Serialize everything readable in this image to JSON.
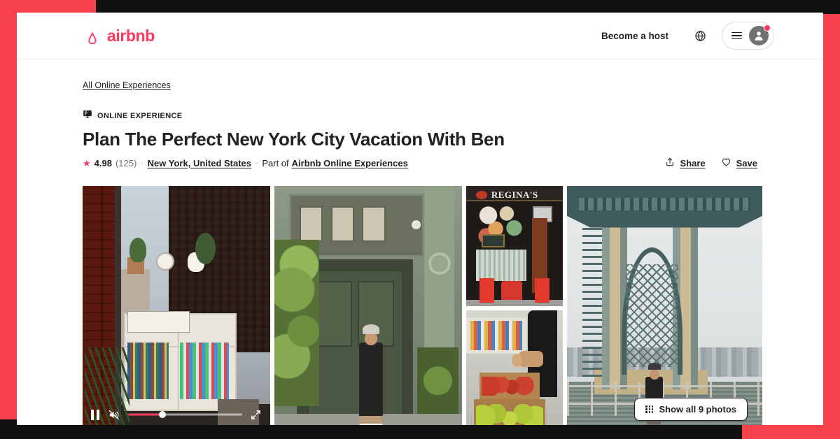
{
  "theme": {
    "brand_color": "#FF385C",
    "accent_red": "#F8404C",
    "backdrop_dark": "#111111",
    "text_primary": "#222222",
    "text_secondary": "#717171"
  },
  "header": {
    "logo_text": "airbnb",
    "logo_icon": "airbnb-belo-icon",
    "become_host_label": "Become a host",
    "globe_icon": "globe-icon",
    "menu_icon": "hamburger-icon",
    "avatar_icon": "user-avatar-icon",
    "notification_dot": true
  },
  "breadcrumb": {
    "label": "All Online Experiences"
  },
  "listing": {
    "badge_icon": "online-broadcast-icon",
    "badge_label": "ONLINE EXPERIENCE",
    "title": "Plan The Perfect New York City Vacation With Ben",
    "star_icon": "star-icon",
    "rating": "4.98",
    "review_count": "(125)",
    "separator": "·",
    "location": "New York, United States",
    "part_of_prefix": "Part of",
    "collection": "Airbnb Online Experiences"
  },
  "actions": {
    "share_icon": "share-upload-icon",
    "share_label": "Share",
    "save_icon": "heart-icon",
    "save_label": "Save"
  },
  "gallery": {
    "show_all_icon": "grid-dots-icon",
    "show_all_label": "Show all 9 photos",
    "photos": [
      {
        "name": "video-shop-window-books",
        "alt": "Storefront window with shelves of books and plants, brick wall"
      },
      {
        "name": "green-doorway-man",
        "alt": "Man leaning by a green painted doorway with greenery"
      },
      {
        "name": "reginas-storefront",
        "alt": "Regina's storefront with red cafe table and chairs"
      },
      {
        "name": "fruit-market-stall",
        "alt": "Crates of apples and limes at a street market stall"
      },
      {
        "name": "manhattan-bridge-tower",
        "alt": "Man by railing beneath the Manhattan Bridge tower"
      }
    ]
  },
  "video_player": {
    "pause_icon": "pause-icon",
    "mute_icon": "volume-muted-icon",
    "fullscreen_icon": "fullscreen-expand-icon",
    "progress_percent": 30
  }
}
